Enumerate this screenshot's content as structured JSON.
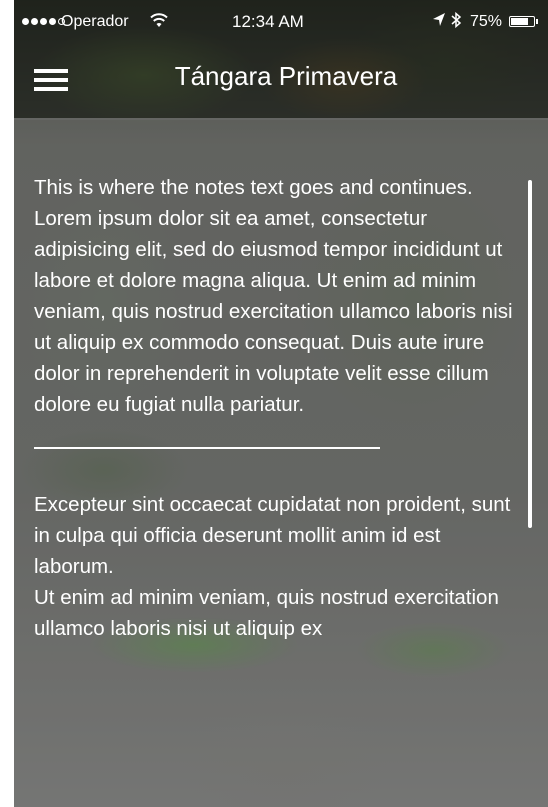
{
  "status_bar": {
    "carrier": "Operador",
    "time": "12:34 AM",
    "battery_percent_label": "75%",
    "battery_level": 0.75
  },
  "nav": {
    "title": "Tángara Primavera",
    "menu_icon": "hamburger-menu-icon"
  },
  "notes": {
    "paragraph_1": "This is where the notes text goes and continues. Lorem ipsum dolor sit ea amet, consectetur adipisicing elit, sed do eiusmod tempor incididunt ut labore et dolore magna aliqua. Ut enim ad minim veniam, quis nostrud exercitation ullamco laboris nisi ut aliquip ex commodo consequat. Duis aute irure dolor in reprehenderit in voluptate velit esse cillum dolore eu fugiat nulla pariatur.",
    "paragraph_2": "Excepteur sint occaecat cupidatat non proident, sunt in culpa qui officia deserunt mollit anim id est laborum.",
    "paragraph_3": "Ut enim ad minim veniam, quis nostrud exercitation ullamco laboris nisi ut aliquip ex"
  },
  "colors": {
    "text": "#ffffff",
    "bar_overlay": "#0a0c08"
  }
}
